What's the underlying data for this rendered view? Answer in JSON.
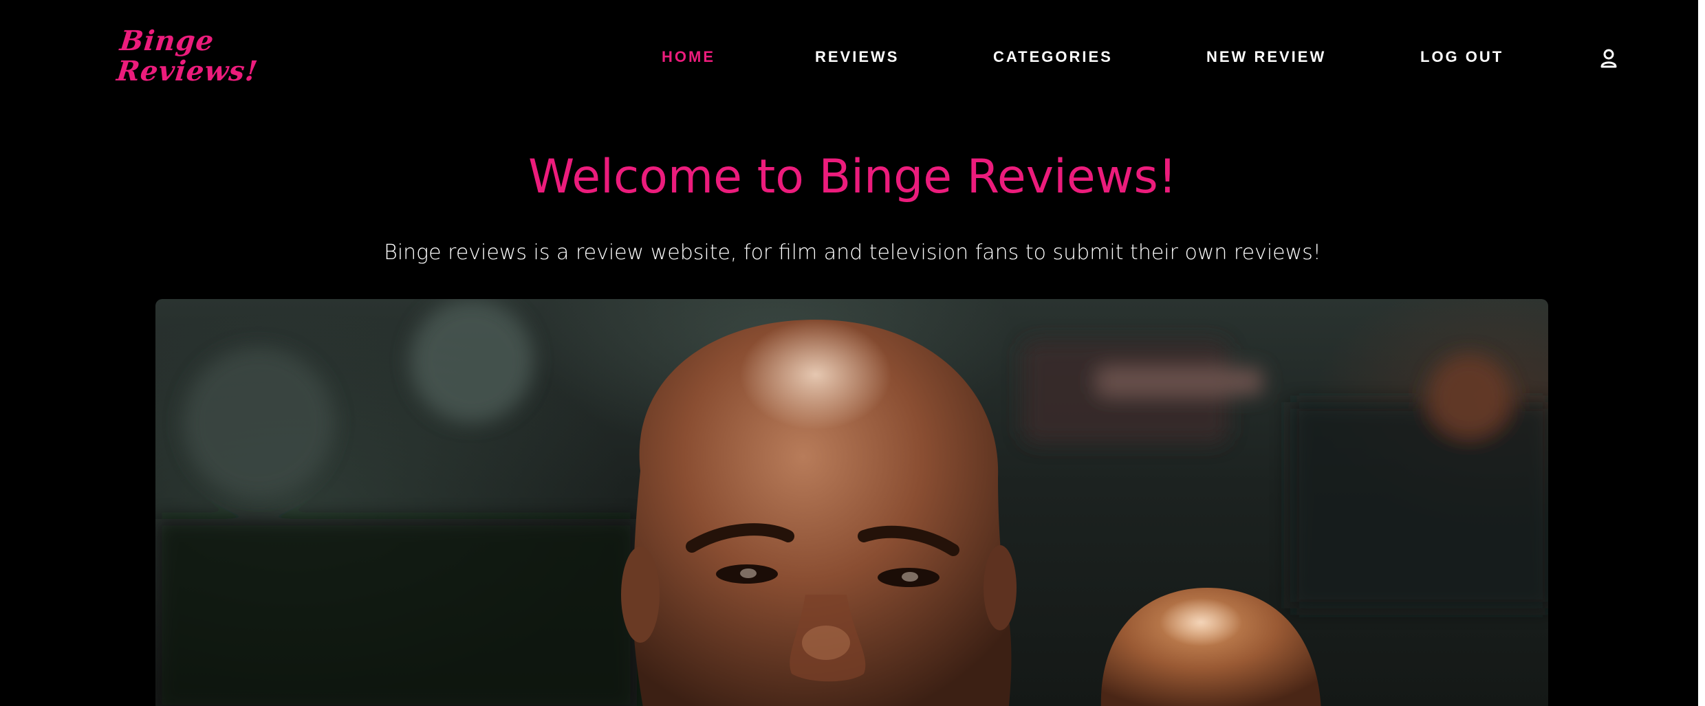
{
  "brand": {
    "logo_text": "Binge\nReviews!",
    "accent_color": "#ec1c7c"
  },
  "nav": {
    "items": [
      {
        "label": "HOME",
        "active": true
      },
      {
        "label": "REVIEWS",
        "active": false
      },
      {
        "label": "CATEGORIES",
        "active": false
      },
      {
        "label": "NEW REVIEW",
        "active": false
      },
      {
        "label": "LOG OUT",
        "active": false
      }
    ],
    "user_icon": "user-icon"
  },
  "hero": {
    "title": "Welcome to Binge Reviews!",
    "subtitle": "Binge reviews is a review website, for film and television fans to submit their own reviews!"
  }
}
